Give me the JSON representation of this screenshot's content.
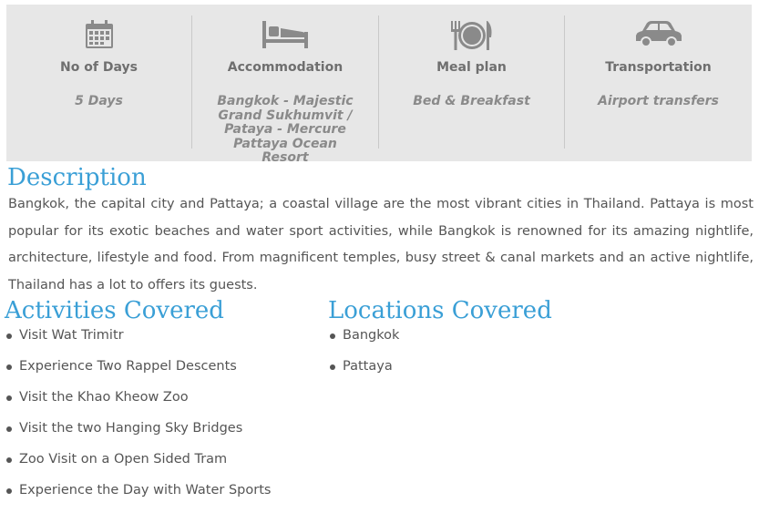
{
  "info": [
    {
      "icon": "calendar-icon",
      "title": "No of Days",
      "value": "5 Days"
    },
    {
      "icon": "bed-icon",
      "title": "Accommodation",
      "value": "Bangkok - Majestic Grand Sukhumvit / Pataya - Mercure Pattaya Ocean Resort"
    },
    {
      "icon": "meal-icon",
      "title": "Meal plan",
      "value": "Bed & Breakfast"
    },
    {
      "icon": "car-icon",
      "title": "Transportation",
      "value": "Airport transfers"
    }
  ],
  "description": {
    "heading": "Description",
    "text": "Bangkok, the capital city and Pattaya; a coastal village are the most vibrant cities in Thailand. Pattaya is most popular for its exotic beaches and water sport activities, while Bangkok is renowned for its amazing nightlife, architecture, lifestyle and food. From magnificent temples, busy street & canal markets and an active nightlife, Thailand has a lot to offers its guests."
  },
  "activities": {
    "heading": "Activities Covered",
    "items": [
      "Visit Wat Trimitr",
      "Experience Two Rappel Descents",
      "Visit the Khao Kheow Zoo",
      "Visit the two Hanging Sky Bridges",
      "Zoo Visit on a Open Sided Tram",
      "Experience the Day with Water Sports"
    ]
  },
  "locations": {
    "heading": "Locations Covered",
    "items": [
      "Bangkok",
      "Pattaya"
    ]
  },
  "colors": {
    "panel": "#e7e7e7",
    "accent": "#3a9fd6",
    "icon": "#8a8a8a"
  }
}
